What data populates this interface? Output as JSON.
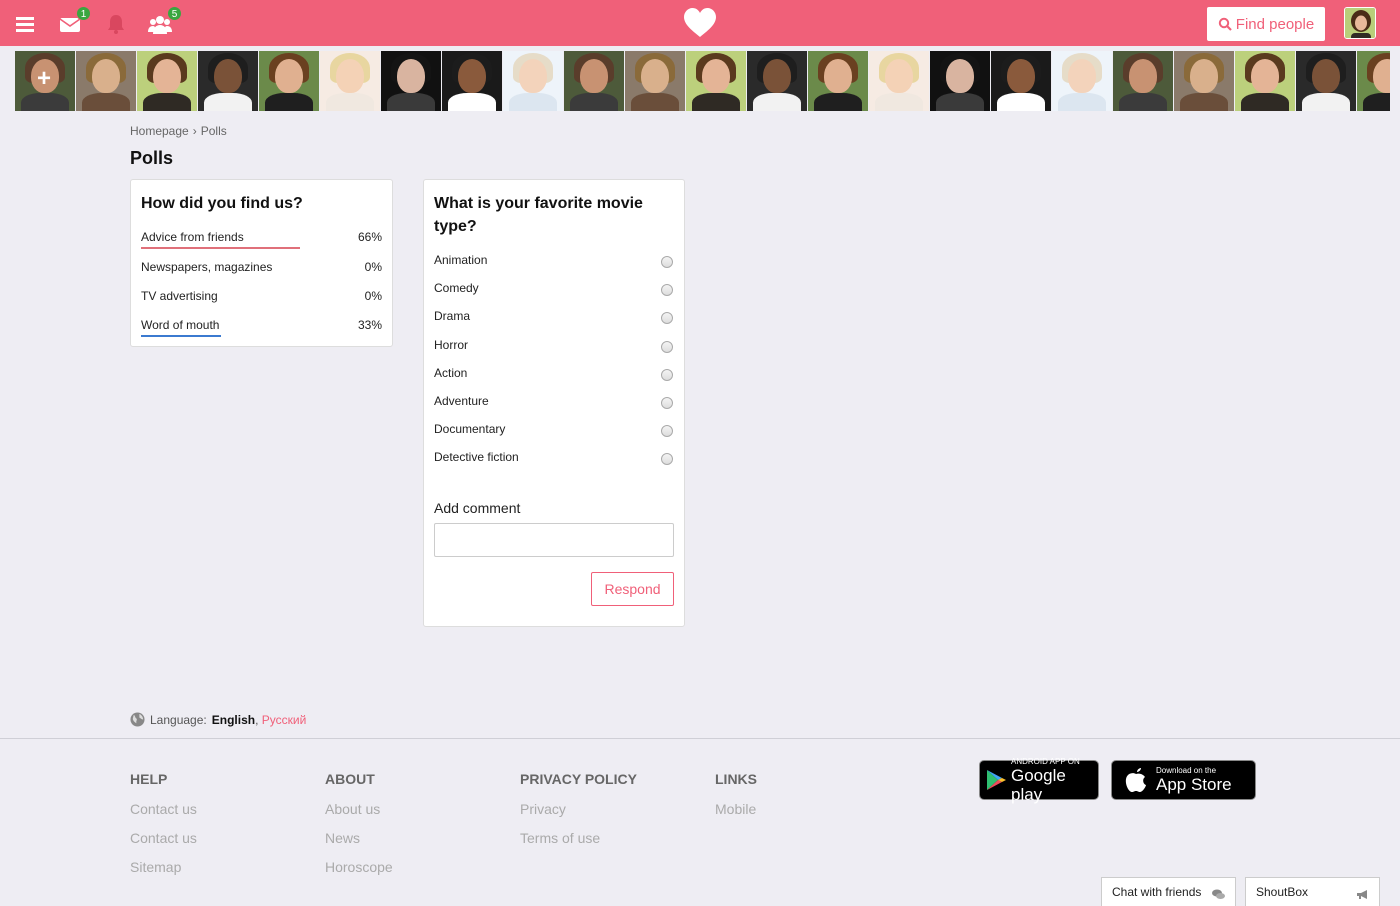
{
  "topbar": {
    "mail_badge": "1",
    "friends_badge": "5",
    "find_label": "Find people",
    "brand_color": "#f06079"
  },
  "icons": {
    "menu": "menu-icon",
    "mail": "envelope-icon",
    "bell": "bell-icon",
    "friends": "users-icon",
    "logo": "heart-icon",
    "search": "search-icon"
  },
  "breadcrumb": {
    "home": "Homepage",
    "current": "Polls"
  },
  "page_title": "Polls",
  "poll1": {
    "question": "How did you find us?",
    "results": [
      {
        "label": "Advice from friends",
        "percent": "66%",
        "fraction": 0.66,
        "color": "#e0707a"
      },
      {
        "label": "Newspapers, magazines",
        "percent": "0%",
        "fraction": 0,
        "color": "#e0707a"
      },
      {
        "label": "TV advertising",
        "percent": "0%",
        "fraction": 0,
        "color": "#e0707a"
      },
      {
        "label": "Word of mouth",
        "percent": "33%",
        "fraction": 0.33,
        "color": "#3b7ad0"
      }
    ]
  },
  "poll2": {
    "question": "What is your favorite movie type?",
    "options": [
      "Animation",
      "Comedy",
      "Drama",
      "Horror",
      "Action",
      "Adventure",
      "Documentary",
      "Detective fiction"
    ],
    "comment_label": "Add comment",
    "comment_value": "",
    "respond_label": "Respond"
  },
  "language": {
    "label": "Language:",
    "current": "English",
    "separator": ",",
    "alternate": "Русский"
  },
  "footer": {
    "help": {
      "title": "HELP",
      "links": [
        "Contact us",
        "Contact us",
        "Sitemap"
      ]
    },
    "about": {
      "title": "ABOUT",
      "links": [
        "About us",
        "News",
        "Horoscope"
      ]
    },
    "privacy": {
      "title": "PRIVACY POLICY",
      "links": [
        "Privacy",
        "Terms of use"
      ]
    },
    "links": {
      "title": "LINKS",
      "links": [
        "Mobile"
      ]
    }
  },
  "stores": {
    "google_small": "ANDROID APP ON",
    "google_big": "Google play",
    "apple_small": "Download on the",
    "apple_big": "App Store"
  },
  "chat": {
    "friends_label": "Chat with friends",
    "shoutbox_label": "ShoutBox"
  }
}
